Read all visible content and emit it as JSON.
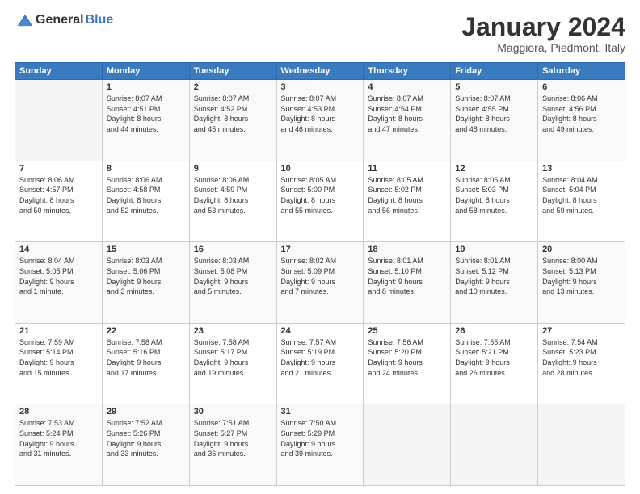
{
  "logo": {
    "general": "General",
    "blue": "Blue"
  },
  "title": "January 2024",
  "subtitle": "Maggiora, Piedmont, Italy",
  "weekdays": [
    "Sunday",
    "Monday",
    "Tuesday",
    "Wednesday",
    "Thursday",
    "Friday",
    "Saturday"
  ],
  "weeks": [
    [
      {
        "day": "",
        "info": ""
      },
      {
        "day": "1",
        "info": "Sunrise: 8:07 AM\nSunset: 4:51 PM\nDaylight: 8 hours\nand 44 minutes."
      },
      {
        "day": "2",
        "info": "Sunrise: 8:07 AM\nSunset: 4:52 PM\nDaylight: 8 hours\nand 45 minutes."
      },
      {
        "day": "3",
        "info": "Sunrise: 8:07 AM\nSunset: 4:53 PM\nDaylight: 8 hours\nand 46 minutes."
      },
      {
        "day": "4",
        "info": "Sunrise: 8:07 AM\nSunset: 4:54 PM\nDaylight: 8 hours\nand 47 minutes."
      },
      {
        "day": "5",
        "info": "Sunrise: 8:07 AM\nSunset: 4:55 PM\nDaylight: 8 hours\nand 48 minutes."
      },
      {
        "day": "6",
        "info": "Sunrise: 8:06 AM\nSunset: 4:56 PM\nDaylight: 8 hours\nand 49 minutes."
      }
    ],
    [
      {
        "day": "7",
        "info": "Sunrise: 8:06 AM\nSunset: 4:57 PM\nDaylight: 8 hours\nand 50 minutes."
      },
      {
        "day": "8",
        "info": "Sunrise: 8:06 AM\nSunset: 4:58 PM\nDaylight: 8 hours\nand 52 minutes."
      },
      {
        "day": "9",
        "info": "Sunrise: 8:06 AM\nSunset: 4:59 PM\nDaylight: 8 hours\nand 53 minutes."
      },
      {
        "day": "10",
        "info": "Sunrise: 8:05 AM\nSunset: 5:00 PM\nDaylight: 8 hours\nand 55 minutes."
      },
      {
        "day": "11",
        "info": "Sunrise: 8:05 AM\nSunset: 5:02 PM\nDaylight: 8 hours\nand 56 minutes."
      },
      {
        "day": "12",
        "info": "Sunrise: 8:05 AM\nSunset: 5:03 PM\nDaylight: 8 hours\nand 58 minutes."
      },
      {
        "day": "13",
        "info": "Sunrise: 8:04 AM\nSunset: 5:04 PM\nDaylight: 8 hours\nand 59 minutes."
      }
    ],
    [
      {
        "day": "14",
        "info": "Sunrise: 8:04 AM\nSunset: 5:05 PM\nDaylight: 9 hours\nand 1 minute."
      },
      {
        "day": "15",
        "info": "Sunrise: 8:03 AM\nSunset: 5:06 PM\nDaylight: 9 hours\nand 3 minutes."
      },
      {
        "day": "16",
        "info": "Sunrise: 8:03 AM\nSunset: 5:08 PM\nDaylight: 9 hours\nand 5 minutes."
      },
      {
        "day": "17",
        "info": "Sunrise: 8:02 AM\nSunset: 5:09 PM\nDaylight: 9 hours\nand 7 minutes."
      },
      {
        "day": "18",
        "info": "Sunrise: 8:01 AM\nSunset: 5:10 PM\nDaylight: 9 hours\nand 8 minutes."
      },
      {
        "day": "19",
        "info": "Sunrise: 8:01 AM\nSunset: 5:12 PM\nDaylight: 9 hours\nand 10 minutes."
      },
      {
        "day": "20",
        "info": "Sunrise: 8:00 AM\nSunset: 5:13 PM\nDaylight: 9 hours\nand 13 minutes."
      }
    ],
    [
      {
        "day": "21",
        "info": "Sunrise: 7:59 AM\nSunset: 5:14 PM\nDaylight: 9 hours\nand 15 minutes."
      },
      {
        "day": "22",
        "info": "Sunrise: 7:58 AM\nSunset: 5:16 PM\nDaylight: 9 hours\nand 17 minutes."
      },
      {
        "day": "23",
        "info": "Sunrise: 7:58 AM\nSunset: 5:17 PM\nDaylight: 9 hours\nand 19 minutes."
      },
      {
        "day": "24",
        "info": "Sunrise: 7:57 AM\nSunset: 5:19 PM\nDaylight: 9 hours\nand 21 minutes."
      },
      {
        "day": "25",
        "info": "Sunrise: 7:56 AM\nSunset: 5:20 PM\nDaylight: 9 hours\nand 24 minutes."
      },
      {
        "day": "26",
        "info": "Sunrise: 7:55 AM\nSunset: 5:21 PM\nDaylight: 9 hours\nand 26 minutes."
      },
      {
        "day": "27",
        "info": "Sunrise: 7:54 AM\nSunset: 5:23 PM\nDaylight: 9 hours\nand 28 minutes."
      }
    ],
    [
      {
        "day": "28",
        "info": "Sunrise: 7:53 AM\nSunset: 5:24 PM\nDaylight: 9 hours\nand 31 minutes."
      },
      {
        "day": "29",
        "info": "Sunrise: 7:52 AM\nSunset: 5:26 PM\nDaylight: 9 hours\nand 33 minutes."
      },
      {
        "day": "30",
        "info": "Sunrise: 7:51 AM\nSunset: 5:27 PM\nDaylight: 9 hours\nand 36 minutes."
      },
      {
        "day": "31",
        "info": "Sunrise: 7:50 AM\nSunset: 5:29 PM\nDaylight: 9 hours\nand 39 minutes."
      },
      {
        "day": "",
        "info": ""
      },
      {
        "day": "",
        "info": ""
      },
      {
        "day": "",
        "info": ""
      }
    ]
  ]
}
